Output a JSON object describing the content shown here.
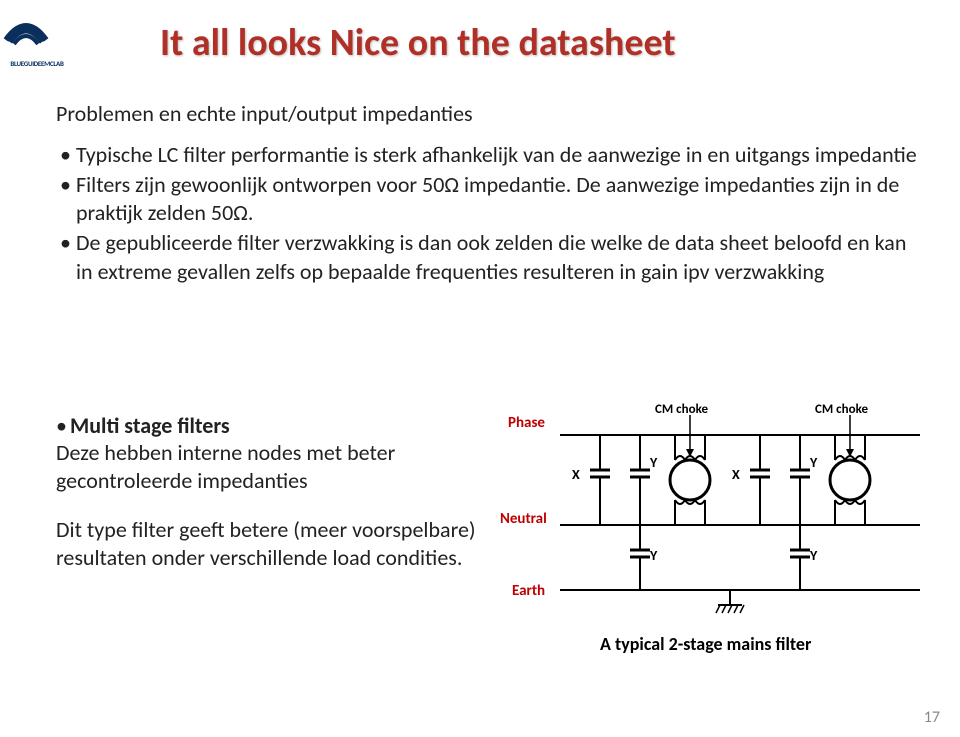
{
  "logo": {
    "text": "BLUEGUIDEEMCLAB"
  },
  "title": "It all looks Nice  on the datasheet",
  "intro": "Problemen en echte input/output impedanties",
  "bullets": {
    "b1": "Typische LC filter performantie is sterk afhankelijk van de aanwezige in en uitgangs impedantie",
    "b2": "Filters zijn gewoonlijk ontworpen voor 50Ω impedantie. De aanwezige impedanties zijn in de praktijk zelden 50Ω.",
    "b3": "De gepubliceerde filter verzwakking is dan ook zelden die welke de data sheet beloofd en kan in extreme gevallen zelfs op bepaalde frequenties resulteren in gain ipv verzwakking"
  },
  "sub": {
    "heading_bullet": "•",
    "heading": "Multi stage filters",
    "p1": "Deze hebben interne nodes met beter gecontroleerde impedanties",
    "p2": "Dit type filter geeft betere (meer voorspelbare) resultaten onder verschillende load condities."
  },
  "diagram": {
    "phase": "Phase",
    "neutral": "Neutral",
    "earth": "Earth",
    "cm1": "CM choke",
    "cm2": "CM choke",
    "x1": "X",
    "y1": "Y",
    "x2": "X",
    "y2": "Y",
    "y3": "Y",
    "y4": "Y",
    "caption": "A typical 2-stage mains filter"
  },
  "page_number": "17"
}
